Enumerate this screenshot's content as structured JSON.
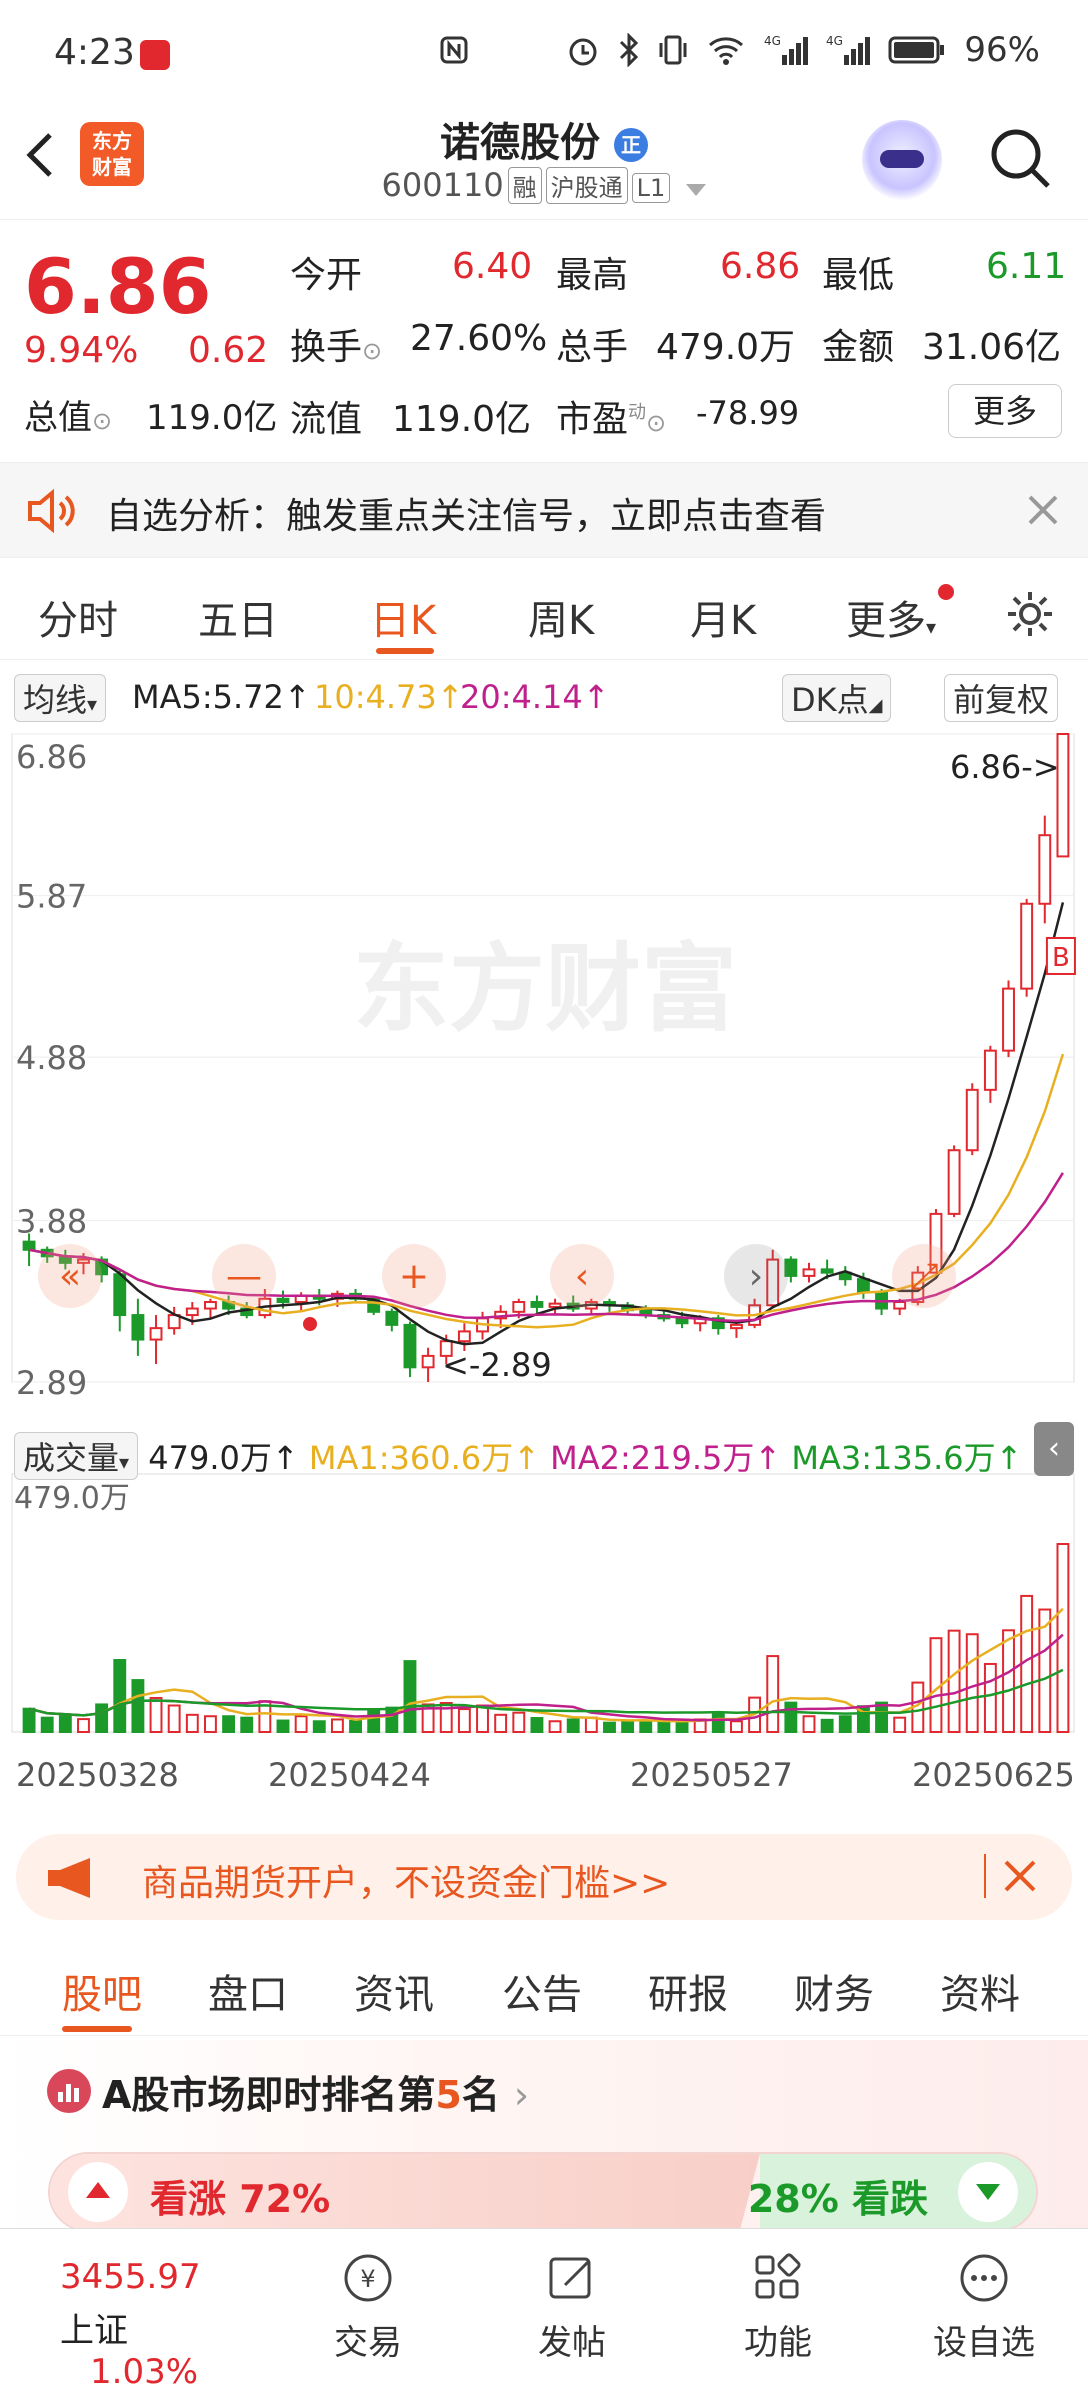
{
  "status_bar": {
    "time": "4:23",
    "battery": "96%",
    "icons": [
      "nfc-icon",
      "alarm-icon",
      "bluetooth-icon",
      "vibrate-icon",
      "wifi-icon",
      "signal-4g-icon",
      "signal-4g-icon-2",
      "battery-icon"
    ]
  },
  "header": {
    "logo_text": "东方\n财富",
    "stock_name": "诺德股份",
    "name_badge": "正",
    "stock_code": "600110",
    "tags": [
      "融",
      "沪股通",
      "L1"
    ]
  },
  "quote": {
    "price": "6.86",
    "change_pct": "9.94%",
    "change_amt": "0.62",
    "open_label": "今开",
    "open": "6.40",
    "high_label": "最高",
    "high": "6.86",
    "low_label": "最低",
    "low": "6.11",
    "turnover_label": "换手",
    "turnover": "27.60%",
    "volume_label": "总手",
    "volume": "479.0万",
    "amount_label": "金额",
    "amount": "31.06亿",
    "mktcap_label": "总值",
    "mktcap": "119.0亿",
    "float_label": "流值",
    "float": "119.0亿",
    "pe_label": "市盈",
    "pe_sup": "动",
    "pe": "-78.99",
    "more_label": "更多"
  },
  "banner": {
    "text": "自选分析：触发重点关注信号，立即点击查看"
  },
  "kline_tabs": [
    "分时",
    "五日",
    "日K",
    "周K",
    "月K",
    "更多"
  ],
  "kline_active": 2,
  "chart_controls": {
    "ma_type": "均线",
    "ma5": "MA5:5.72↑",
    "ma10": "10:4.73↑",
    "ma20": "20:4.14↑",
    "dk": "DK点",
    "adjust": "前复权",
    "max_label": "6.86->",
    "min_label": "<-2.89",
    "b_marker": "B",
    "watermark": "东方财富",
    "vol_type": "成交量",
    "vol_value": "479.0万↑",
    "vol_ma1": "MA1:360.6万↑",
    "vol_ma2": "MA2:219.5万↑",
    "vol_ma3": "MA3:135.6万↑",
    "vol_max_label": "479.0万"
  },
  "chart_data": {
    "type": "candlestick",
    "price_axis": {
      "ticks": [
        "6.86",
        "5.87",
        "4.88",
        "3.88",
        "2.89"
      ],
      "range": [
        2.89,
        6.86
      ]
    },
    "dates": [
      "20250328",
      "20250424",
      "20250527",
      "20250625"
    ],
    "series": [
      {
        "name": "MA5",
        "color": "#222222"
      },
      {
        "name": "MA10",
        "color": "#e8b020"
      },
      {
        "name": "MA20",
        "color": "#c0208c"
      }
    ],
    "candles": [
      [
        3.75,
        3.8,
        3.6,
        3.7
      ],
      [
        3.7,
        3.72,
        3.62,
        3.66
      ],
      [
        3.66,
        3.7,
        3.58,
        3.62
      ],
      [
        3.62,
        3.68,
        3.55,
        3.64
      ],
      [
        3.64,
        3.66,
        3.5,
        3.55
      ],
      [
        3.55,
        3.58,
        3.2,
        3.3
      ],
      [
        3.3,
        3.4,
        3.05,
        3.15
      ],
      [
        3.15,
        3.3,
        3.0,
        3.22
      ],
      [
        3.22,
        3.35,
        3.18,
        3.3
      ],
      [
        3.3,
        3.38,
        3.24,
        3.34
      ],
      [
        3.34,
        3.4,
        3.28,
        3.38
      ],
      [
        3.38,
        3.42,
        3.3,
        3.34
      ],
      [
        3.34,
        3.38,
        3.28,
        3.3
      ],
      [
        3.3,
        3.46,
        3.28,
        3.4
      ],
      [
        3.4,
        3.45,
        3.34,
        3.38
      ],
      [
        3.38,
        3.44,
        3.32,
        3.42
      ],
      [
        3.42,
        3.46,
        3.36,
        3.4
      ],
      [
        3.4,
        3.45,
        3.35,
        3.43
      ],
      [
        3.43,
        3.46,
        3.38,
        3.4
      ],
      [
        3.4,
        3.42,
        3.3,
        3.32
      ],
      [
        3.32,
        3.34,
        3.2,
        3.24
      ],
      [
        3.24,
        3.26,
        2.92,
        2.98
      ],
      [
        2.98,
        3.1,
        2.89,
        3.05
      ],
      [
        3.05,
        3.18,
        3.0,
        3.14
      ],
      [
        3.14,
        3.25,
        3.08,
        3.2
      ],
      [
        3.2,
        3.32,
        3.15,
        3.28
      ],
      [
        3.28,
        3.36,
        3.22,
        3.32
      ],
      [
        3.32,
        3.4,
        3.28,
        3.38
      ],
      [
        3.38,
        3.42,
        3.3,
        3.35
      ],
      [
        3.35,
        3.4,
        3.3,
        3.37
      ],
      [
        3.37,
        3.42,
        3.32,
        3.34
      ],
      [
        3.34,
        3.4,
        3.3,
        3.38
      ],
      [
        3.38,
        3.4,
        3.32,
        3.36
      ],
      [
        3.36,
        3.38,
        3.3,
        3.33
      ],
      [
        3.33,
        3.36,
        3.28,
        3.3
      ],
      [
        3.3,
        3.34,
        3.26,
        3.28
      ],
      [
        3.28,
        3.32,
        3.22,
        3.25
      ],
      [
        3.25,
        3.3,
        3.2,
        3.28
      ],
      [
        3.28,
        3.3,
        3.18,
        3.22
      ],
      [
        3.22,
        3.26,
        3.16,
        3.24
      ],
      [
        3.24,
        3.4,
        3.22,
        3.36
      ],
      [
        3.36,
        3.7,
        3.34,
        3.64
      ],
      [
        3.64,
        3.66,
        3.5,
        3.54
      ],
      [
        3.54,
        3.62,
        3.5,
        3.58
      ],
      [
        3.58,
        3.64,
        3.52,
        3.56
      ],
      [
        3.56,
        3.6,
        3.48,
        3.52
      ],
      [
        3.52,
        3.56,
        3.4,
        3.44
      ],
      [
        3.44,
        3.46,
        3.3,
        3.34
      ],
      [
        3.34,
        3.4,
        3.3,
        3.38
      ],
      [
        3.38,
        3.6,
        3.36,
        3.56
      ],
      [
        3.56,
        3.95,
        3.54,
        3.92
      ],
      [
        3.92,
        4.34,
        3.9,
        4.31
      ],
      [
        4.31,
        4.72,
        4.28,
        4.68
      ],
      [
        4.68,
        4.95,
        4.6,
        4.92
      ],
      [
        4.92,
        5.35,
        4.88,
        5.3
      ],
      [
        5.3,
        5.85,
        5.25,
        5.82
      ],
      [
        5.82,
        6.36,
        5.7,
        6.24
      ],
      [
        6.11,
        6.86,
        6.11,
        6.86
      ]
    ],
    "volume": {
      "max": "479.0万"
    }
  },
  "chart_nav": [
    "prev-fast",
    "minus",
    "plus",
    "prev",
    "next",
    "fullscreen"
  ],
  "ad": {
    "text": "商品期货开户，不设资金门槛>>"
  },
  "bottom_tabs": [
    "股吧",
    "盘口",
    "资讯",
    "公告",
    "研报",
    "财务",
    "资料"
  ],
  "bottom_active": 0,
  "rank": {
    "prefix": "A股市场即时排名第",
    "num": "5",
    "suffix": "名",
    "up_label": "看涨 72%",
    "down_label": "28% 看跌",
    "up_pct": 72
  },
  "bottom_nav": {
    "index_value": "3455.97",
    "index_name": "上证",
    "index_change": "1.03%",
    "items": [
      "交易",
      "发帖",
      "功能",
      "设自选"
    ]
  },
  "colors": {
    "up": "#e0282e",
    "down": "#1b9a2a",
    "accent": "#e8571f"
  }
}
